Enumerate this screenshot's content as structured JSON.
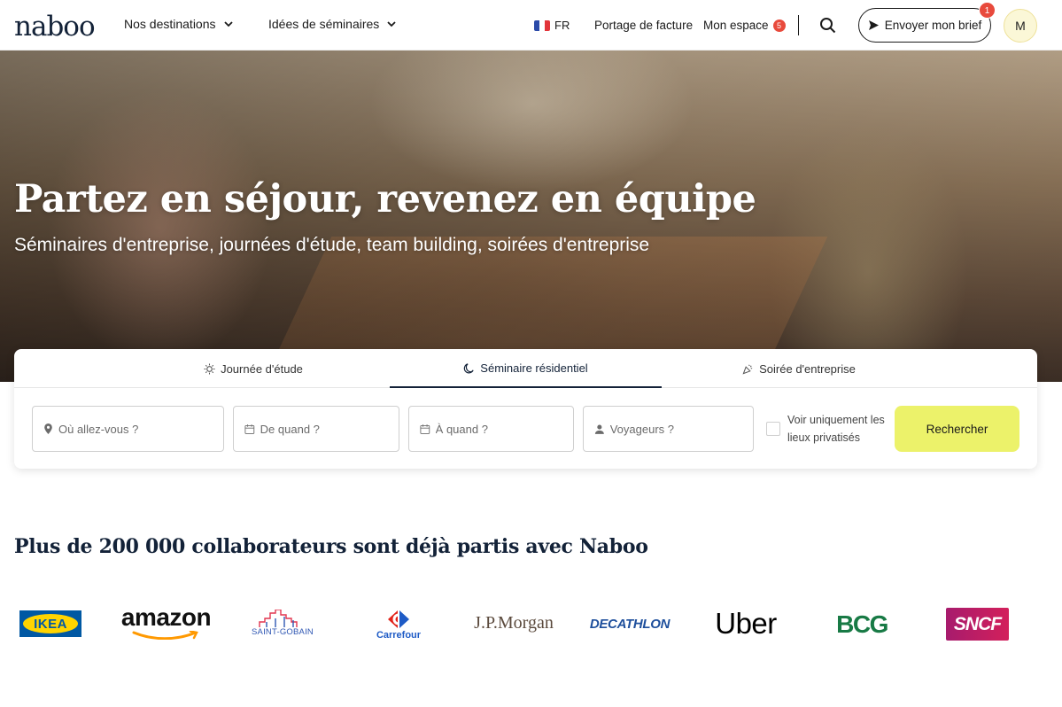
{
  "header": {
    "logo": "naboo",
    "nav": [
      {
        "label": "Nos destinations"
      },
      {
        "label": "Idées de séminaires"
      }
    ],
    "lang": "FR",
    "invoice_link": "Portage de facture",
    "space_link": "Mon espace",
    "space_badge": "5",
    "brief_button": "Envoyer mon brief",
    "brief_badge": "1",
    "avatar_initial": "M"
  },
  "hero": {
    "title": "Partez en séjour, revenez en équipe",
    "subtitle": "Séminaires d'entreprise, journées d'étude, team building, soirées d'entreprise"
  },
  "search": {
    "tabs": [
      {
        "label": "Journée d'étude",
        "icon": "sun-icon"
      },
      {
        "label": "Séminaire résidentiel",
        "icon": "moon-icon",
        "active": true
      },
      {
        "label": "Soirée d'entreprise",
        "icon": "party-icon"
      }
    ],
    "fields": {
      "where": "Où allez-vous ?",
      "from": "De quand ?",
      "to": "À quand ?",
      "travelers": "Voyageurs ?"
    },
    "private_only_label": "Voir uniquement les lieux privatisés",
    "submit": "Rechercher"
  },
  "proof": {
    "title": "Plus de 200 000 collaborateurs sont déjà partis avec Naboo",
    "logos": {
      "ikea": "IKEA",
      "amazon": "amazon",
      "saint_gobain": "SAINT-GOBAIN",
      "carrefour": "Carrefour",
      "jpmorgan": "J.P.Morgan",
      "decathlon": "DECATHLON",
      "uber": "Uber",
      "bcg": "BCG",
      "sncf": "SNCF"
    }
  },
  "colors": {
    "navy": "#132238",
    "accent_yellow": "#ecf26a",
    "badge_red": "#e84a3c"
  }
}
